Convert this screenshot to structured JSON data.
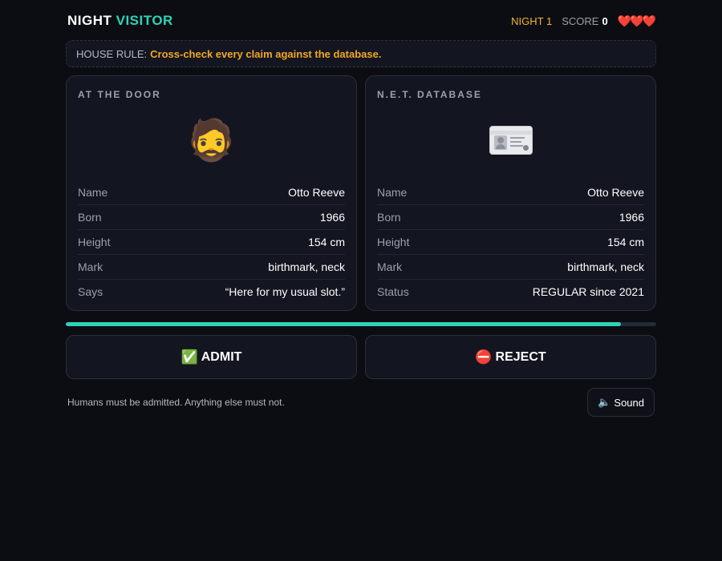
{
  "header": {
    "title_a": "NIGHT",
    "title_b": "VISITOR",
    "night": "NIGHT 1",
    "score_label": "SCORE",
    "score_value": "0",
    "lives": "❤️❤️❤️"
  },
  "rule": {
    "label": "HOUSE RULE:",
    "text": "Cross-check every claim against the database."
  },
  "door": {
    "heading": "AT THE DOOR",
    "avatar": "🧔",
    "rows": [
      {
        "key": "Name",
        "value": "Otto Reeve"
      },
      {
        "key": "Born",
        "value": "1966"
      },
      {
        "key": "Height",
        "value": "154 cm"
      },
      {
        "key": "Mark",
        "value": "birthmark, neck"
      },
      {
        "key": "Says",
        "value": "“Here for my usual slot.”"
      }
    ]
  },
  "database": {
    "heading": "N.E.T. DATABASE",
    "icon": "id-card-icon",
    "rows": [
      {
        "key": "Name",
        "value": "Otto Reeve"
      },
      {
        "key": "Born",
        "value": "1966"
      },
      {
        "key": "Height",
        "value": "154 cm"
      },
      {
        "key": "Mark",
        "value": "birthmark, neck"
      },
      {
        "key": "Status",
        "value": "REGULAR since 2021"
      }
    ]
  },
  "timer": {
    "fraction": 0.94
  },
  "actions": {
    "admit_icon": "✅",
    "admit_label": "ADMIT",
    "reject_icon": "⛔",
    "reject_label": "REJECT"
  },
  "footer": {
    "hint": "Humans must be admitted. Anything else must not.",
    "sound_icon": "🔈",
    "sound_label": "Sound"
  },
  "colors": {
    "accent": "#2ed3b7",
    "warning": "#f5a623",
    "night": "#f5b52e",
    "background": "#0c0d12"
  }
}
